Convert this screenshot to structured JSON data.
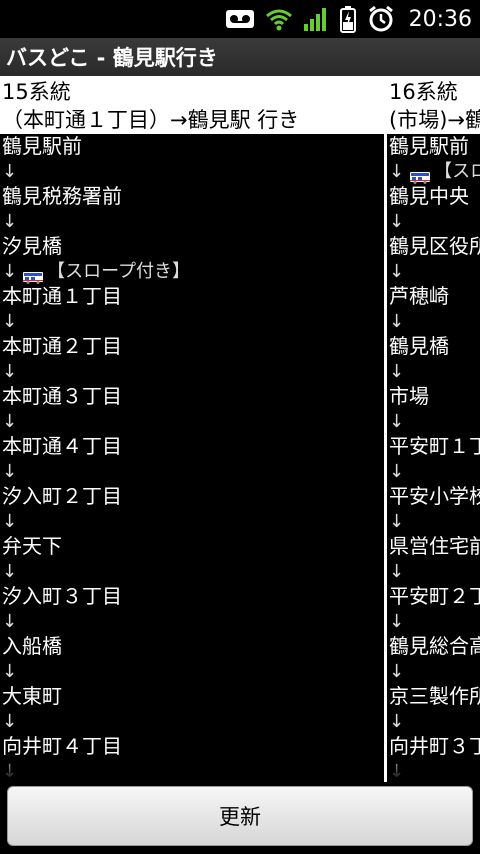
{
  "status": {
    "time": "20:36"
  },
  "app": {
    "title": "バスどこ - 鶴見駅行き"
  },
  "columns": [
    {
      "route_line1": "15系統",
      "route_line2": "（本町通１丁目）→鶴見駅 行き",
      "rows": [
        {
          "type": "stop",
          "text": "鶴見駅前"
        },
        {
          "type": "arrow",
          "text": "↓"
        },
        {
          "type": "stop",
          "text": "鶴見税務署前"
        },
        {
          "type": "arrow",
          "text": "↓"
        },
        {
          "type": "stop",
          "text": "汐見橋"
        },
        {
          "type": "arrow",
          "text": "↓",
          "bus": true,
          "note": "【スロープ付き】"
        },
        {
          "type": "stop",
          "text": "本町通１丁目"
        },
        {
          "type": "arrow",
          "text": "↓"
        },
        {
          "type": "stop",
          "text": "本町通２丁目"
        },
        {
          "type": "arrow",
          "text": "↓"
        },
        {
          "type": "stop",
          "text": "本町通３丁目"
        },
        {
          "type": "arrow",
          "text": "↓"
        },
        {
          "type": "stop",
          "text": "本町通４丁目"
        },
        {
          "type": "arrow",
          "text": "↓"
        },
        {
          "type": "stop",
          "text": "汐入町２丁目"
        },
        {
          "type": "arrow",
          "text": "↓"
        },
        {
          "type": "stop",
          "text": "弁天下"
        },
        {
          "type": "arrow",
          "text": "↓"
        },
        {
          "type": "stop",
          "text": "汐入町３丁目"
        },
        {
          "type": "arrow",
          "text": "↓"
        },
        {
          "type": "stop",
          "text": "入船橋"
        },
        {
          "type": "arrow",
          "text": "↓"
        },
        {
          "type": "stop",
          "text": "大東町"
        },
        {
          "type": "arrow",
          "text": "↓"
        },
        {
          "type": "stop",
          "text": "向井町４丁目"
        },
        {
          "type": "arrow",
          "text": "↓"
        }
      ]
    },
    {
      "route_line1": "16系統",
      "route_line2": "(市場)→鶴",
      "rows": [
        {
          "type": "stop",
          "text": "鶴見駅前"
        },
        {
          "type": "arrow",
          "text": "↓",
          "bus": true,
          "note": "【スロ"
        },
        {
          "type": "stop",
          "text": "鶴見中央"
        },
        {
          "type": "arrow",
          "text": "↓"
        },
        {
          "type": "stop",
          "text": "鶴見区役所"
        },
        {
          "type": "arrow",
          "text": "↓"
        },
        {
          "type": "stop",
          "text": "芦穂崎"
        },
        {
          "type": "arrow",
          "text": "↓"
        },
        {
          "type": "stop",
          "text": "鶴見橋"
        },
        {
          "type": "arrow",
          "text": "↓"
        },
        {
          "type": "stop",
          "text": "市場"
        },
        {
          "type": "arrow",
          "text": "↓"
        },
        {
          "type": "stop",
          "text": "平安町１丁"
        },
        {
          "type": "arrow",
          "text": "↓"
        },
        {
          "type": "stop",
          "text": "平安小学校"
        },
        {
          "type": "arrow",
          "text": "↓"
        },
        {
          "type": "stop",
          "text": "県営住宅前"
        },
        {
          "type": "arrow",
          "text": "↓"
        },
        {
          "type": "stop",
          "text": "平安町２丁"
        },
        {
          "type": "arrow",
          "text": "↓"
        },
        {
          "type": "stop",
          "text": "鶴見総合高"
        },
        {
          "type": "arrow",
          "text": "↓"
        },
        {
          "type": "stop",
          "text": "京三製作所"
        },
        {
          "type": "arrow",
          "text": "↓"
        },
        {
          "type": "stop",
          "text": "向井町３丁"
        },
        {
          "type": "arrow",
          "text": "↓"
        }
      ]
    }
  ],
  "refresh_label": "更新",
  "colors": {
    "accent_bar": "#2a2a2a",
    "button": "#e6e6e6"
  }
}
